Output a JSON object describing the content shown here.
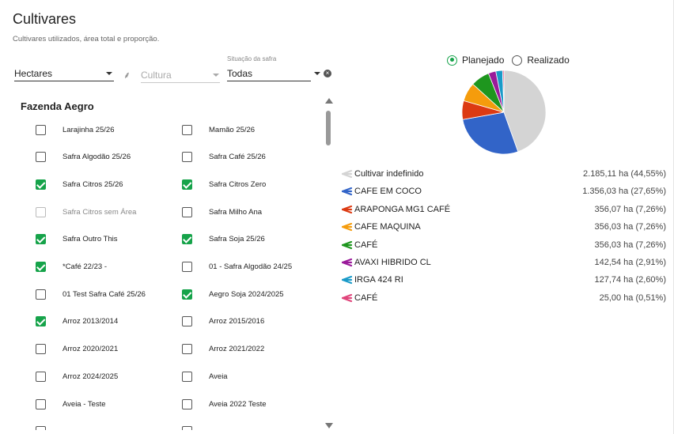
{
  "header": {
    "title": "Cultivares",
    "subtitle": "Cultivares utilizados, área total e proporção."
  },
  "filters": {
    "unit": {
      "value": "Hectares"
    },
    "culture": {
      "placeholder": "Cultura"
    },
    "season_status": {
      "label": "Situação da safra",
      "value": "Todas"
    }
  },
  "farm": {
    "name": "Fazenda Aegro"
  },
  "crops": [
    {
      "label": "Larajinha 25/26",
      "checked": false
    },
    {
      "label": "Mamão 25/26",
      "checked": false
    },
    {
      "label": "Safra Algodão 25/26",
      "checked": false
    },
    {
      "label": "Safra Café 25/26",
      "checked": false
    },
    {
      "label": "Safra Citros 25/26",
      "checked": true
    },
    {
      "label": "Safra Citros Zero",
      "checked": true
    },
    {
      "label": "Safra Citros sem Área",
      "checked": false,
      "disabled": true
    },
    {
      "label": "Safra Milho Ana",
      "checked": false
    },
    {
      "label": "Safra Outro This",
      "checked": true
    },
    {
      "label": "Safra Soja 25/26",
      "checked": true
    },
    {
      "label": "*Café 22/23 -",
      "checked": true
    },
    {
      "label": "01 - Safra Algodão 24/25",
      "checked": false
    },
    {
      "label": "01 Test Safra Café 25/26",
      "checked": false
    },
    {
      "label": "Aegro Soja 2024/2025",
      "checked": true
    },
    {
      "label": "Arroz 2013/2014",
      "checked": true
    },
    {
      "label": "Arroz 2015/2016",
      "checked": false
    },
    {
      "label": "Arroz 2020/2021",
      "checked": false
    },
    {
      "label": "Arroz 2021/2022",
      "checked": false
    },
    {
      "label": "Arroz 2024/2025",
      "checked": false
    },
    {
      "label": "Aveia",
      "checked": false
    },
    {
      "label": "Aveia - Teste",
      "checked": false
    },
    {
      "label": "Aveia 2022 Teste",
      "checked": false
    },
    {
      "label": "",
      "checked": false
    },
    {
      "label": "",
      "checked": false
    }
  ],
  "view_mode": {
    "options": [
      {
        "label": "Planejado",
        "selected": true
      },
      {
        "label": "Realizado",
        "selected": false
      }
    ]
  },
  "chart_data": {
    "type": "pie",
    "series": [
      {
        "name": "Cultivar indefinido",
        "value": 2185.11,
        "percent": 44.55,
        "color": "#d4d4d4",
        "label": "2.185,11 ha (44,55%)"
      },
      {
        "name": "CAFE EM COCO",
        "value": 1356.03,
        "percent": 27.65,
        "color": "#3264c8",
        "label": "1.356,03 ha (27,65%)"
      },
      {
        "name": "ARAPONGA MG1 CAFÉ",
        "value": 356.07,
        "percent": 7.26,
        "color": "#dc3a12",
        "label": "356,07 ha (7,26%)"
      },
      {
        "name": "CAFE MAQUINA",
        "value": 356.03,
        "percent": 7.26,
        "color": "#f59c0c",
        "label": "356,03 ha (7,26%)"
      },
      {
        "name": "CAFÉ",
        "value": 356.03,
        "percent": 7.26,
        "color": "#1e961e",
        "label": "356,03 ha (7,26%)"
      },
      {
        "name": "AVAXI HIBRIDO CL",
        "value": 142.54,
        "percent": 2.91,
        "color": "#9a1a9a",
        "label": "142,54 ha (2,91%)"
      },
      {
        "name": "IRGA 424 RI",
        "value": 127.74,
        "percent": 2.6,
        "color": "#1a9ac8",
        "label": "127,74 ha (2,60%)"
      },
      {
        "name": "CAFÉ",
        "value": 25.0,
        "percent": 0.51,
        "color": "#e0457b",
        "label": "25,00 ha (0,51%)"
      }
    ]
  }
}
